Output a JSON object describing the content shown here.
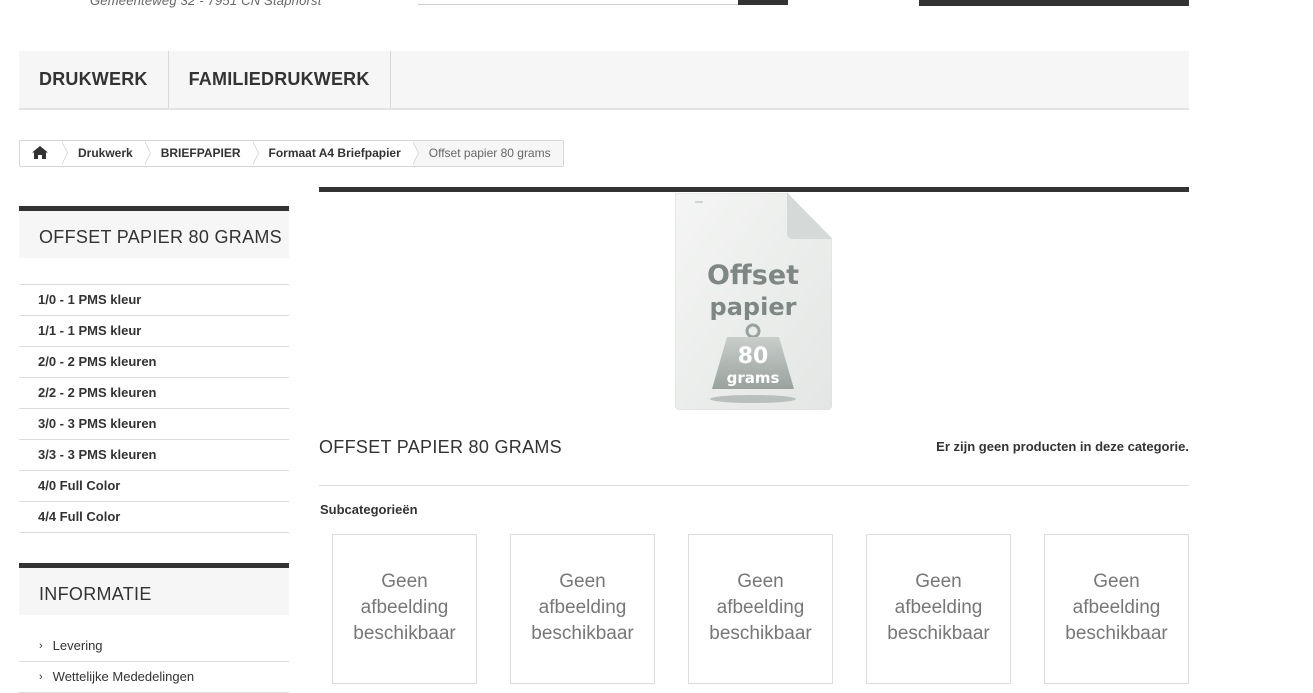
{
  "header": {
    "address": "Gemeenteweg 32 - 7951 CN Staphorst"
  },
  "top_menu": [
    {
      "label": "DRUKWERK"
    },
    {
      "label": "FAMILIEDRUKWERK"
    }
  ],
  "breadcrumb": {
    "home_icon": "home-icon",
    "items": [
      {
        "label": "Drukwerk"
      },
      {
        "label": "BRIEFPAPIER"
      },
      {
        "label": "Formaat A4 Briefpapier"
      }
    ],
    "current": "Offset papier 80 grams"
  },
  "sidebar": {
    "category_title": "OFFSET PAPIER 80 GRAMS",
    "categories": [
      {
        "label": "1/0 - 1 PMS kleur"
      },
      {
        "label": "1/1 - 1 PMS kleur"
      },
      {
        "label": "2/0 - 2 PMS kleuren"
      },
      {
        "label": "2/2 - 2 PMS kleuren"
      },
      {
        "label": "3/0 - 3 PMS kleuren"
      },
      {
        "label": "3/3 - 3 PMS kleuren"
      },
      {
        "label": "4/0 Full Color"
      },
      {
        "label": "4/4 Full Color"
      }
    ],
    "info_title": "INFORMATIE",
    "info_items": [
      {
        "label": "Levering"
      },
      {
        "label": "Wettelijke Mededelingen"
      }
    ]
  },
  "main": {
    "image": {
      "line1": "Offset",
      "line2": "papier",
      "weight_value": "80",
      "weight_unit": "grams"
    },
    "heading": "OFFSET PAPIER 80 GRAMS",
    "no_products": "Er zijn geen producten in deze categorie.",
    "subcategories_label": "Subcategorieën",
    "subcategories": [
      {
        "line1": "Geen",
        "line2": "afbeelding",
        "line3": "beschikbaar"
      },
      {
        "line1": "Geen",
        "line2": "afbeelding",
        "line3": "beschikbaar"
      },
      {
        "line1": "Geen",
        "line2": "afbeelding",
        "line3": "beschikbaar"
      },
      {
        "line1": "Geen",
        "line2": "afbeelding",
        "line3": "beschikbaar"
      },
      {
        "line1": "Geen",
        "line2": "afbeelding",
        "line3": "beschikbaar"
      }
    ]
  },
  "colors": {
    "dark_bar": "#333333",
    "panel_bg": "#f6f6f6",
    "border": "#dcdcdc"
  }
}
